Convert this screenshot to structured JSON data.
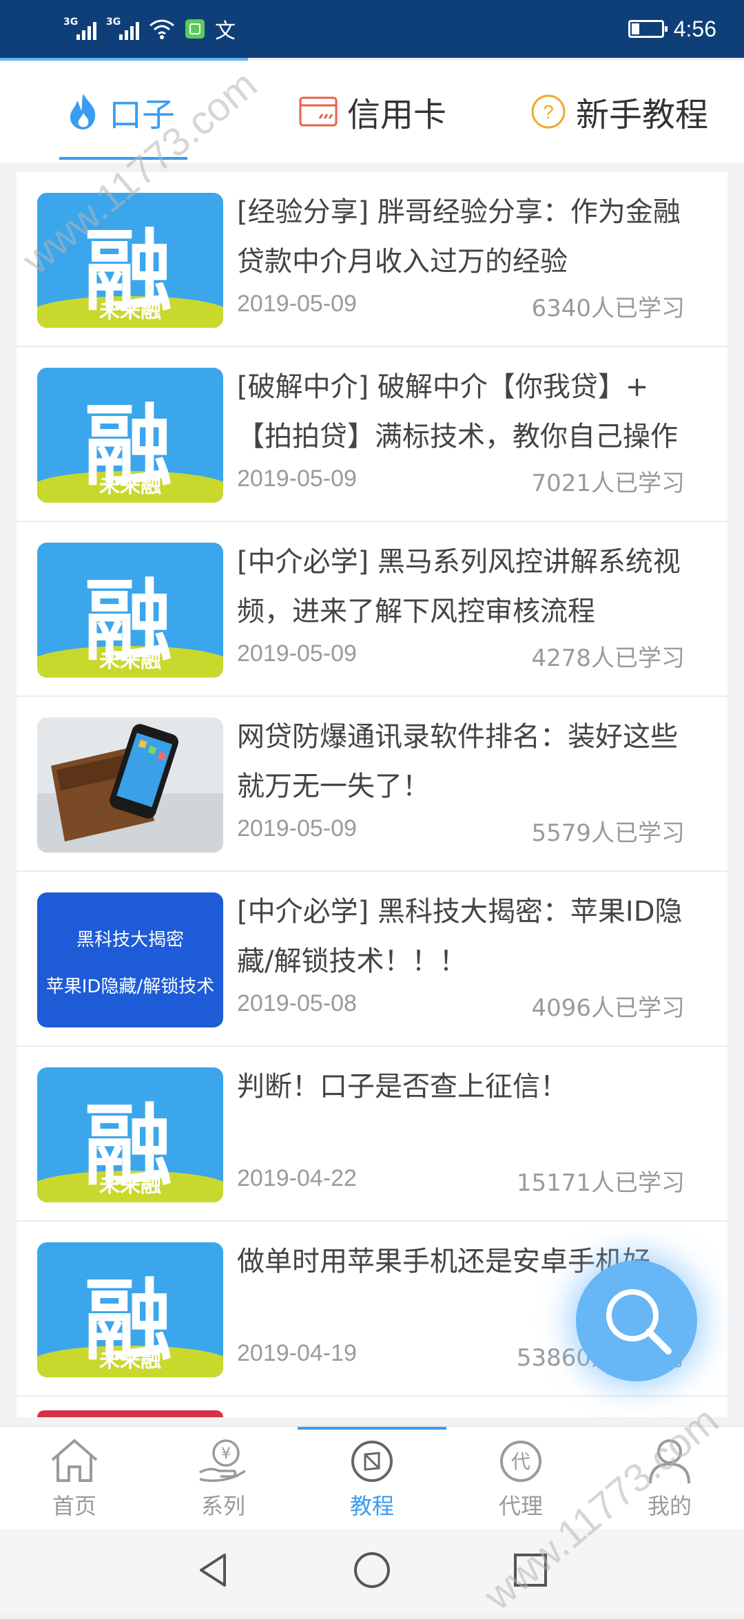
{
  "status_bar": {
    "signal1": "3G",
    "signal2": "3G",
    "extra_icon": "文",
    "battery_level": 0.25,
    "time": "4:56"
  },
  "top_tabs": [
    {
      "label": "口子",
      "icon": "flame-icon",
      "active": true
    },
    {
      "label": "信用卡",
      "icon": "credit-card-icon",
      "active": false
    },
    {
      "label": "新手教程",
      "icon": "question-circle-icon",
      "active": false
    }
  ],
  "articles": [
    {
      "thumb": "rong",
      "thumb_big": "融",
      "thumb_sub": "未来融",
      "title": "[经验分享] 胖哥经验分享：作为金融贷款中介月收入过万的经验",
      "date": "2019-05-09",
      "learners": "6340人已学习"
    },
    {
      "thumb": "rong",
      "thumb_big": "融",
      "thumb_sub": "未来融",
      "title": "[破解中介] 破解中介【你我贷】+【拍拍贷】满标技术，教你自己操作",
      "date": "2019-05-09",
      "learners": "7021人已学习"
    },
    {
      "thumb": "rong",
      "thumb_big": "融",
      "thumb_sub": "未来融",
      "title": "[中介必学] 黑马系列风控讲解系统视频，进来了解下风控审核流程",
      "date": "2019-05-09",
      "learners": "4278人已学习"
    },
    {
      "thumb": "photo",
      "title": "网贷防爆通讯录软件排名：装好这些就万无一失了！",
      "date": "2019-05-09",
      "learners": "5579人已学习"
    },
    {
      "thumb": "blue",
      "thumb_line1": "黑科技大揭密",
      "thumb_line2": "苹果ID隐藏/解锁技术",
      "title": "[中介必学] 黑科技大揭密：苹果ID隐藏/解锁技术！！！",
      "date": "2019-05-08",
      "learners": "4096人已学习"
    },
    {
      "thumb": "rong",
      "thumb_big": "融",
      "thumb_sub": "未来融",
      "title": "判断！口子是否查上征信！",
      "date": "2019-04-22",
      "learners": "15171人已学习"
    },
    {
      "thumb": "rong",
      "thumb_big": "融",
      "thumb_sub": "未来融",
      "title": "做单时用苹果手机还是安卓手机好",
      "date": "2019-04-19",
      "learners": "53860人已学习"
    }
  ],
  "bottom_nav": [
    {
      "label": "首页",
      "icon": "home-icon",
      "active": false
    },
    {
      "label": "系列",
      "icon": "yuan-hand-icon",
      "active": false
    },
    {
      "label": "教程",
      "icon": "compass-icon",
      "active": true
    },
    {
      "label": "代理",
      "icon": "agent-badge-icon",
      "active": false
    },
    {
      "label": "我的",
      "icon": "person-icon",
      "active": false
    }
  ],
  "agent_badge_char": "代",
  "watermark": "www.11773.com",
  "colors": {
    "status_bar": "#0f3f78",
    "accent": "#3a9cf0",
    "thumb_blue": "#3ba6ec",
    "thumb_band": "#c8d82d"
  }
}
